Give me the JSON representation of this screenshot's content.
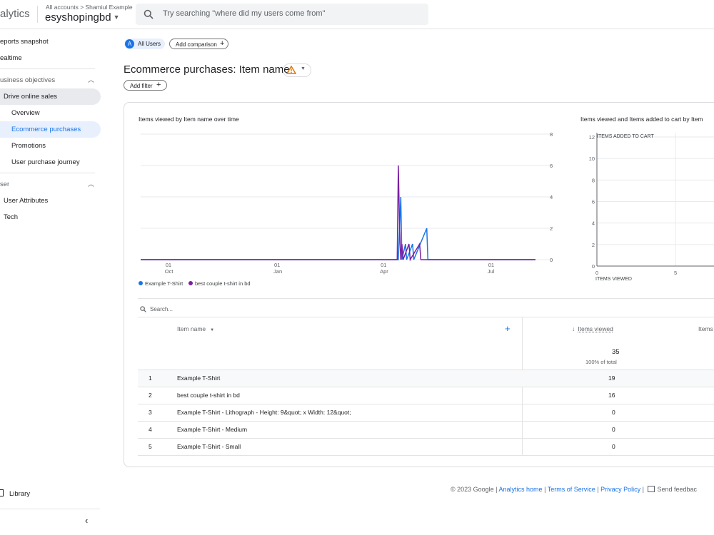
{
  "header": {
    "brand": "alytics",
    "breadcrumb": "All accounts > Shamiul Example",
    "property": "esyshopingbd",
    "search_placeholder": "Try searching \"where did my users come from\""
  },
  "sidebar": {
    "items": [
      {
        "label": "eports snapshot"
      },
      {
        "label": "ealtime"
      },
      {
        "label": "usiness objectives"
      },
      {
        "label": "Drive online sales"
      },
      {
        "label": "Overview"
      },
      {
        "label": "Ecommerce purchases"
      },
      {
        "label": "Promotions"
      },
      {
        "label": "User purchase journey"
      },
      {
        "label": "ser"
      },
      {
        "label": "User Attributes"
      },
      {
        "label": "Tech"
      }
    ],
    "library_label": "Library"
  },
  "toolbar": {
    "segment_letter": "A",
    "segment_label": "All Users",
    "add_comparison": "Add comparison",
    "page_title": "Ecommerce purchases: Item name",
    "add_filter": "Add filter"
  },
  "chart_data": [
    {
      "type": "line",
      "title": "Items viewed by Item name over time",
      "x_ticks": [
        "01 Oct",
        "01 Jan",
        "01 Apr",
        "01 Jul"
      ],
      "y_ticks": [
        0,
        2,
        4,
        6,
        8
      ],
      "ylim": [
        0,
        8
      ],
      "legend_position": "bottom-left",
      "series": [
        {
          "name": "Example T-Shirt",
          "color": "#1a73e8",
          "points": [
            [
              "2023-04-13",
              0
            ],
            [
              "2023-04-14",
              2
            ],
            [
              "2023-04-15",
              4
            ],
            [
              "2023-04-16",
              0
            ],
            [
              "2023-04-19",
              1
            ],
            [
              "2023-04-20",
              0
            ],
            [
              "2023-04-25",
              1
            ],
            [
              "2023-04-26",
              0
            ],
            [
              "2023-05-07",
              2
            ],
            [
              "2023-05-08",
              0
            ]
          ]
        },
        {
          "name": "best couple t-shirt in bd",
          "color": "#7b1fa2",
          "points": [
            [
              "2023-04-12",
              0
            ],
            [
              "2023-04-13",
              6
            ],
            [
              "2023-04-14",
              2
            ],
            [
              "2023-04-15",
              0
            ],
            [
              "2023-04-16",
              1
            ],
            [
              "2023-04-17",
              0
            ],
            [
              "2023-04-22",
              1
            ],
            [
              "2023-04-23",
              0
            ],
            [
              "2023-05-01",
              1
            ],
            [
              "2023-05-02",
              0
            ]
          ]
        }
      ]
    },
    {
      "type": "scatter",
      "title": "Items viewed and Items added to cart by Item",
      "xlabel": "ITEMS VIEWED",
      "ylabel": "ITEMS ADDED TO CART",
      "x_ticks": [
        0,
        5
      ],
      "y_ticks": [
        0,
        2,
        4,
        6,
        8,
        10,
        12
      ],
      "ylim": [
        0,
        12
      ],
      "grid": true
    }
  ],
  "table": {
    "search_placeholder": "Search...",
    "dimension_header": "Item name",
    "metric_header": "Items viewed",
    "metric_header2": "Items",
    "total_value": "35",
    "total_pct": "100% of total",
    "rows": [
      {
        "index": "1",
        "name": "Example T-Shirt",
        "value": "19"
      },
      {
        "index": "2",
        "name": "best couple t-shirt in bd",
        "value": "16"
      },
      {
        "index": "3",
        "name": "Example T-Shirt - Lithograph - Height: 9&quot; x Width: 12&quot;",
        "value": "0"
      },
      {
        "index": "4",
        "name": "Example T-Shirt - Medium",
        "value": "0"
      },
      {
        "index": "5",
        "name": "Example T-Shirt - Small",
        "value": "0"
      }
    ]
  },
  "footer": {
    "copyright": "© 2023 Google |",
    "link1": "Analytics home",
    "link2": "Terms of Service",
    "link3": "Privacy Policy",
    "feedback": "Send feedbac"
  },
  "colors": {
    "accent": "#1a73e8",
    "selected_bg": "#e8f0fe",
    "series2": "#7b1fa2"
  }
}
